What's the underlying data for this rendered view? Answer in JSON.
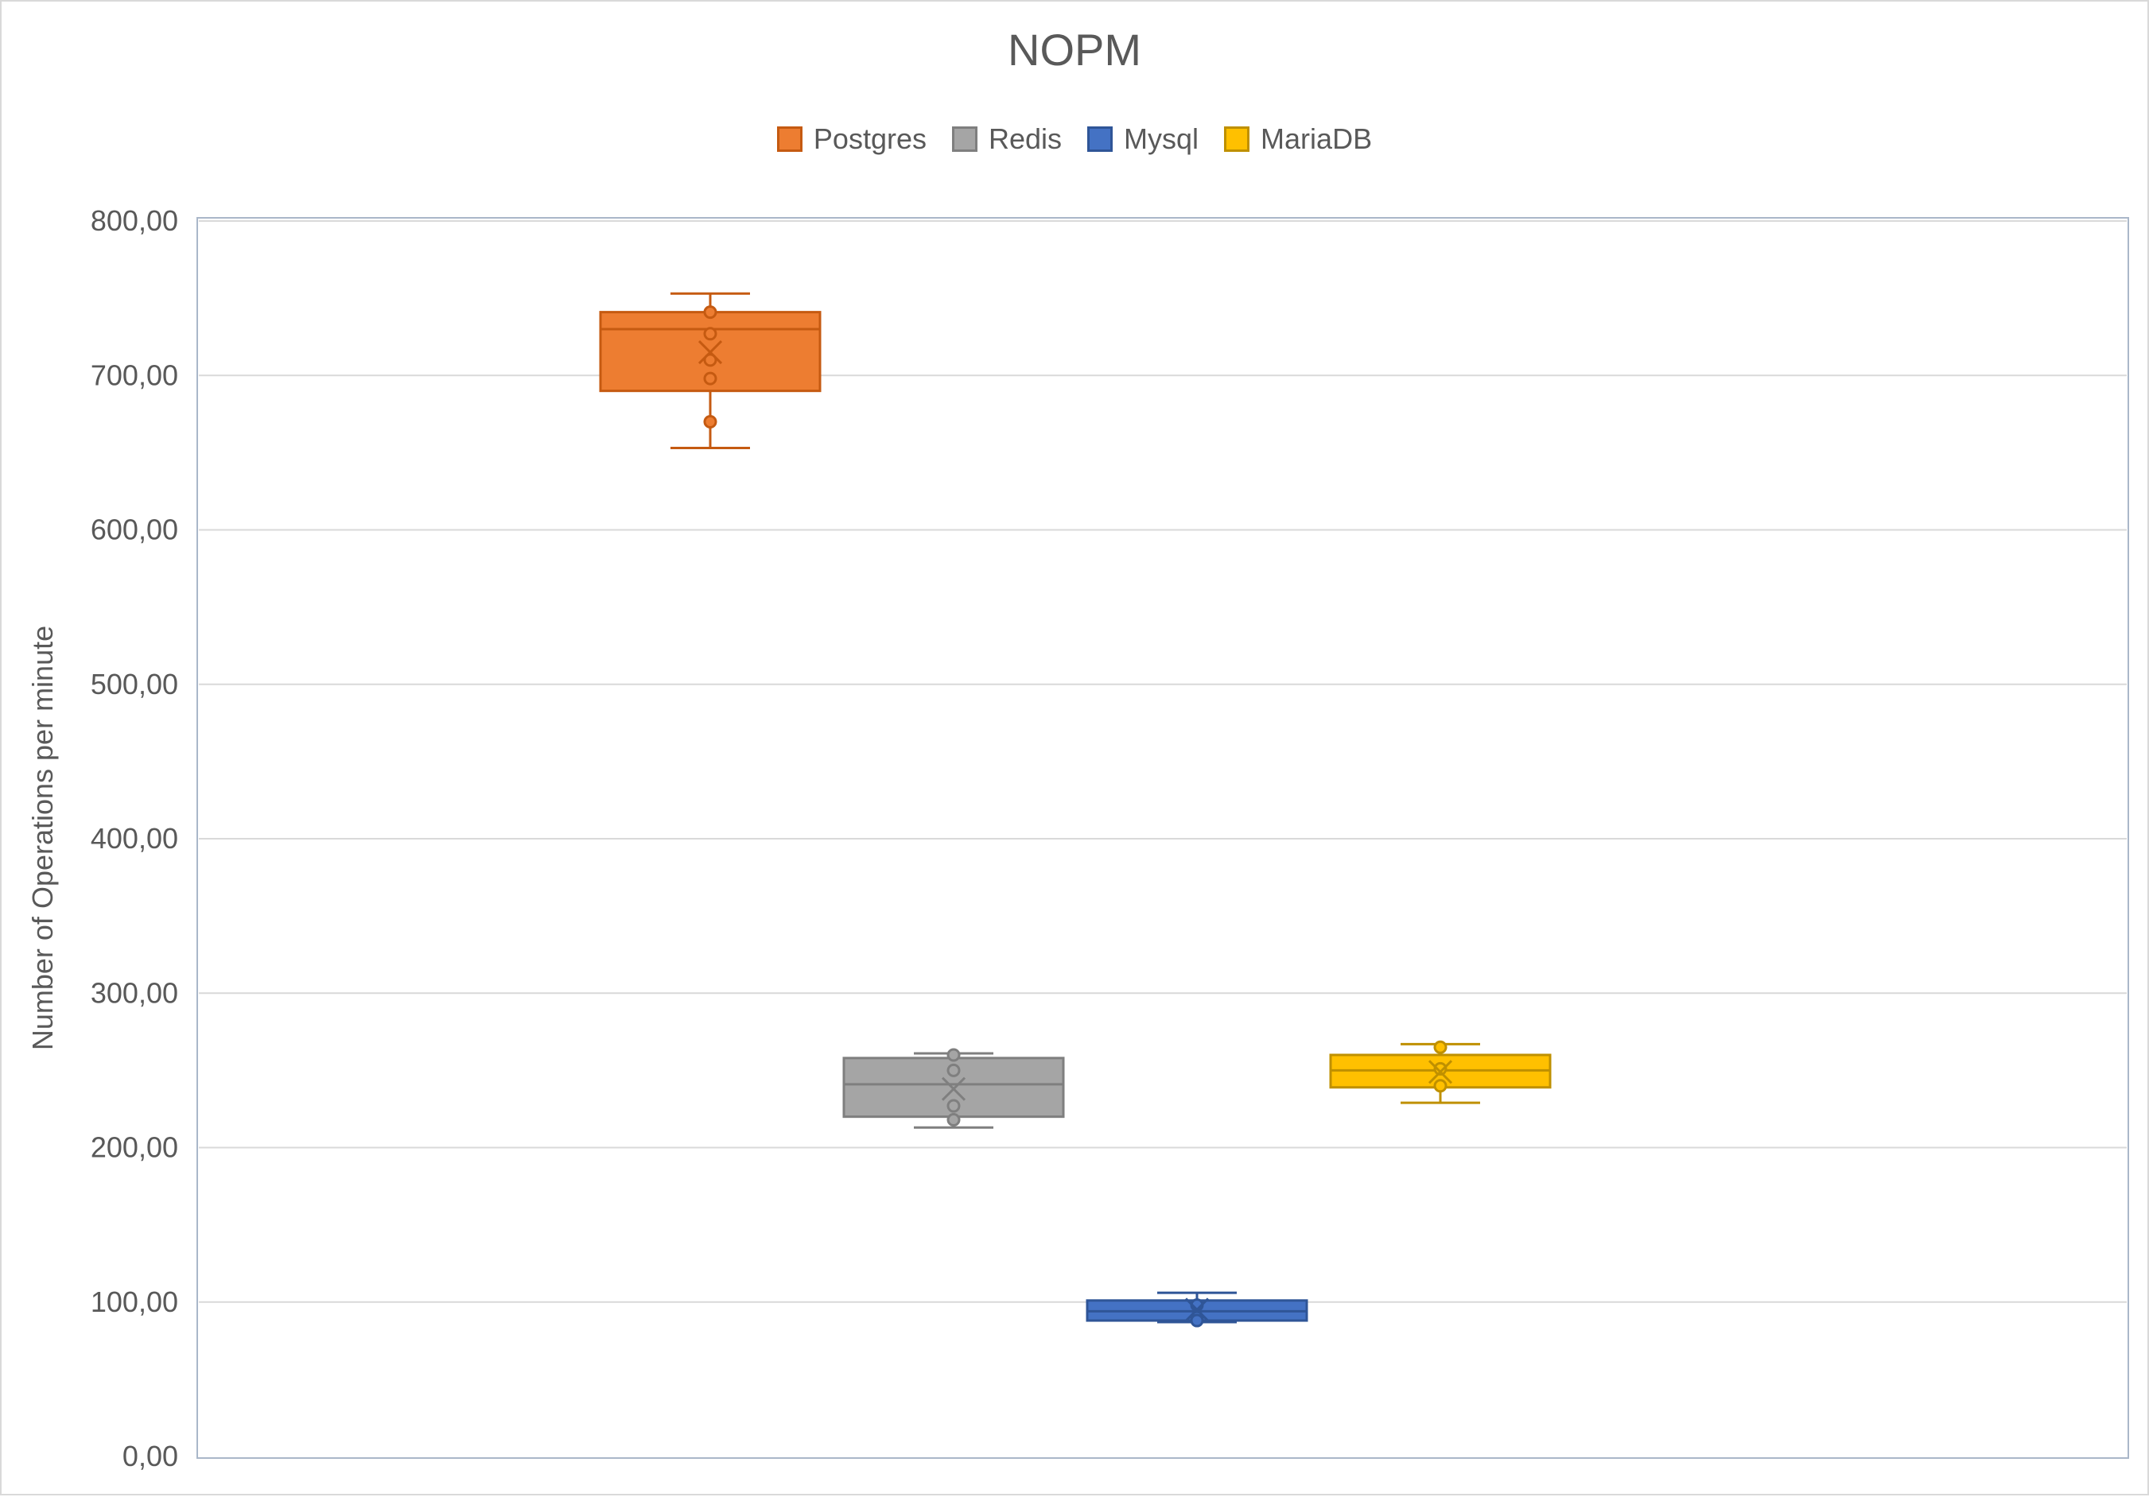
{
  "chart_data": {
    "type": "box",
    "title": "NOPM",
    "ylabel": "Number of Operations per minute",
    "xlabel": "",
    "ylim": [
      0,
      800
    ],
    "yticks": [
      "0,00",
      "100,00",
      "200,00",
      "300,00",
      "400,00",
      "500,00",
      "600,00",
      "700,00",
      "800,00"
    ],
    "ytick_values": [
      0,
      100,
      200,
      300,
      400,
      500,
      600,
      700,
      800
    ],
    "grid": true,
    "legend_position": "top-center",
    "series": [
      {
        "name": "Postgres",
        "color": "#ED7D31",
        "stroke": "#C55A11",
        "min": 653,
        "q1": 690,
        "median": 730,
        "q3": 741,
        "max": 753,
        "mean": 715,
        "points": [
          741,
          727,
          710,
          698,
          670
        ]
      },
      {
        "name": "Redis",
        "color": "#A5A5A5",
        "stroke": "#7F7F7F",
        "min": 213,
        "q1": 220,
        "median": 241,
        "q3": 258,
        "max": 261,
        "mean": 238,
        "points": [
          260,
          250,
          227,
          218
        ]
      },
      {
        "name": "Mysql",
        "color": "#4472C4",
        "stroke": "#2F5597",
        "min": 87,
        "q1": 88,
        "median": 94,
        "q3": 101,
        "max": 106,
        "mean": 95,
        "points": [
          98,
          90,
          88
        ]
      },
      {
        "name": "MariaDB",
        "color": "#FFC000",
        "stroke": "#BF9000",
        "min": 229,
        "q1": 239,
        "median": 250,
        "q3": 260,
        "max": 267,
        "mean": 249,
        "points": [
          265,
          251,
          240
        ]
      }
    ]
  }
}
